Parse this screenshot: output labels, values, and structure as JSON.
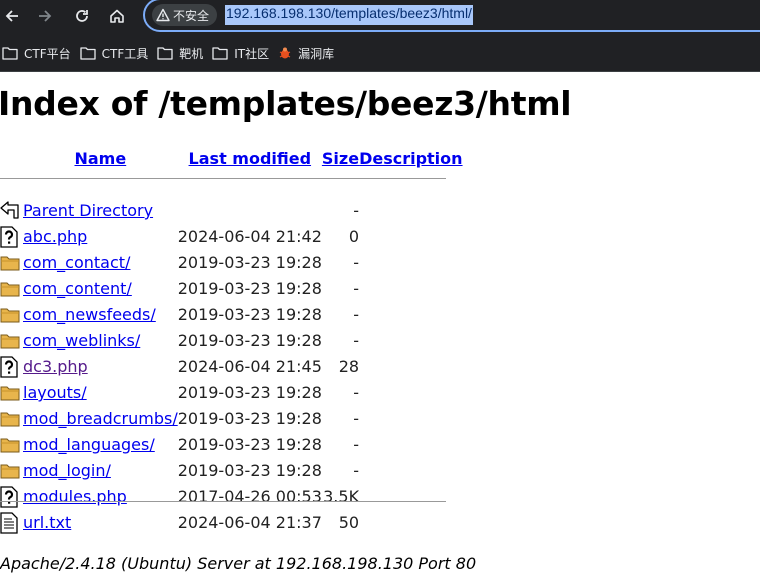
{
  "browser": {
    "security_label": "不安全",
    "url": "192.168.198.130/templates/beez3/html/",
    "bookmarks": [
      {
        "label": "CTF平台",
        "icon": "folder-icon"
      },
      {
        "label": "CTF工具",
        "icon": "folder-icon"
      },
      {
        "label": "靶机",
        "icon": "folder-icon"
      },
      {
        "label": "IT社区",
        "icon": "folder-icon"
      },
      {
        "label": "漏洞库",
        "icon": "bug-favicon-icon"
      }
    ],
    "colors": {
      "chrome_bg": "#202124",
      "omnibox_border": "#7cacf8",
      "url_highlight": "#a8c7fa"
    }
  },
  "page": {
    "title": "Index of /templates/beez3/html",
    "columns": {
      "name": "Name",
      "last_modified": "Last modified",
      "size": "Size",
      "description": "Description"
    },
    "parent": {
      "name": "Parent Directory",
      "size": "-"
    },
    "entries": [
      {
        "name": "abc.php",
        "modified": "2024-06-04 21:42",
        "size": "0",
        "icon": "unknown-file-icon"
      },
      {
        "name": "com_contact/",
        "modified": "2019-03-23 19:28",
        "size": "-",
        "icon": "folder-icon"
      },
      {
        "name": "com_content/",
        "modified": "2019-03-23 19:28",
        "size": "-",
        "icon": "folder-icon"
      },
      {
        "name": "com_newsfeeds/",
        "modified": "2019-03-23 19:28",
        "size": "-",
        "icon": "folder-icon"
      },
      {
        "name": "com_weblinks/",
        "modified": "2019-03-23 19:28",
        "size": "-",
        "icon": "folder-icon"
      },
      {
        "name": "dc3.php",
        "modified": "2024-06-04 21:45",
        "size": "28",
        "icon": "unknown-file-icon",
        "visited": true
      },
      {
        "name": "layouts/",
        "modified": "2019-03-23 19:28",
        "size": "-",
        "icon": "folder-icon"
      },
      {
        "name": "mod_breadcrumbs/",
        "modified": "2019-03-23 19:28",
        "size": "-",
        "icon": "folder-icon"
      },
      {
        "name": "mod_languages/",
        "modified": "2019-03-23 19:28",
        "size": "-",
        "icon": "folder-icon"
      },
      {
        "name": "mod_login/",
        "modified": "2019-03-23 19:28",
        "size": "-",
        "icon": "folder-icon"
      },
      {
        "name": "modules.php",
        "modified": "2017-04-26 00:53",
        "size": "3.5K",
        "icon": "unknown-file-icon"
      },
      {
        "name": "url.txt",
        "modified": "2024-06-04 21:37",
        "size": "50",
        "icon": "text-file-icon"
      }
    ],
    "footer": "Apache/2.4.18 (Ubuntu) Server at 192.168.198.130 Port 80",
    "colors": {
      "link": "#0000ee",
      "visited_link": "#551a8b"
    }
  }
}
